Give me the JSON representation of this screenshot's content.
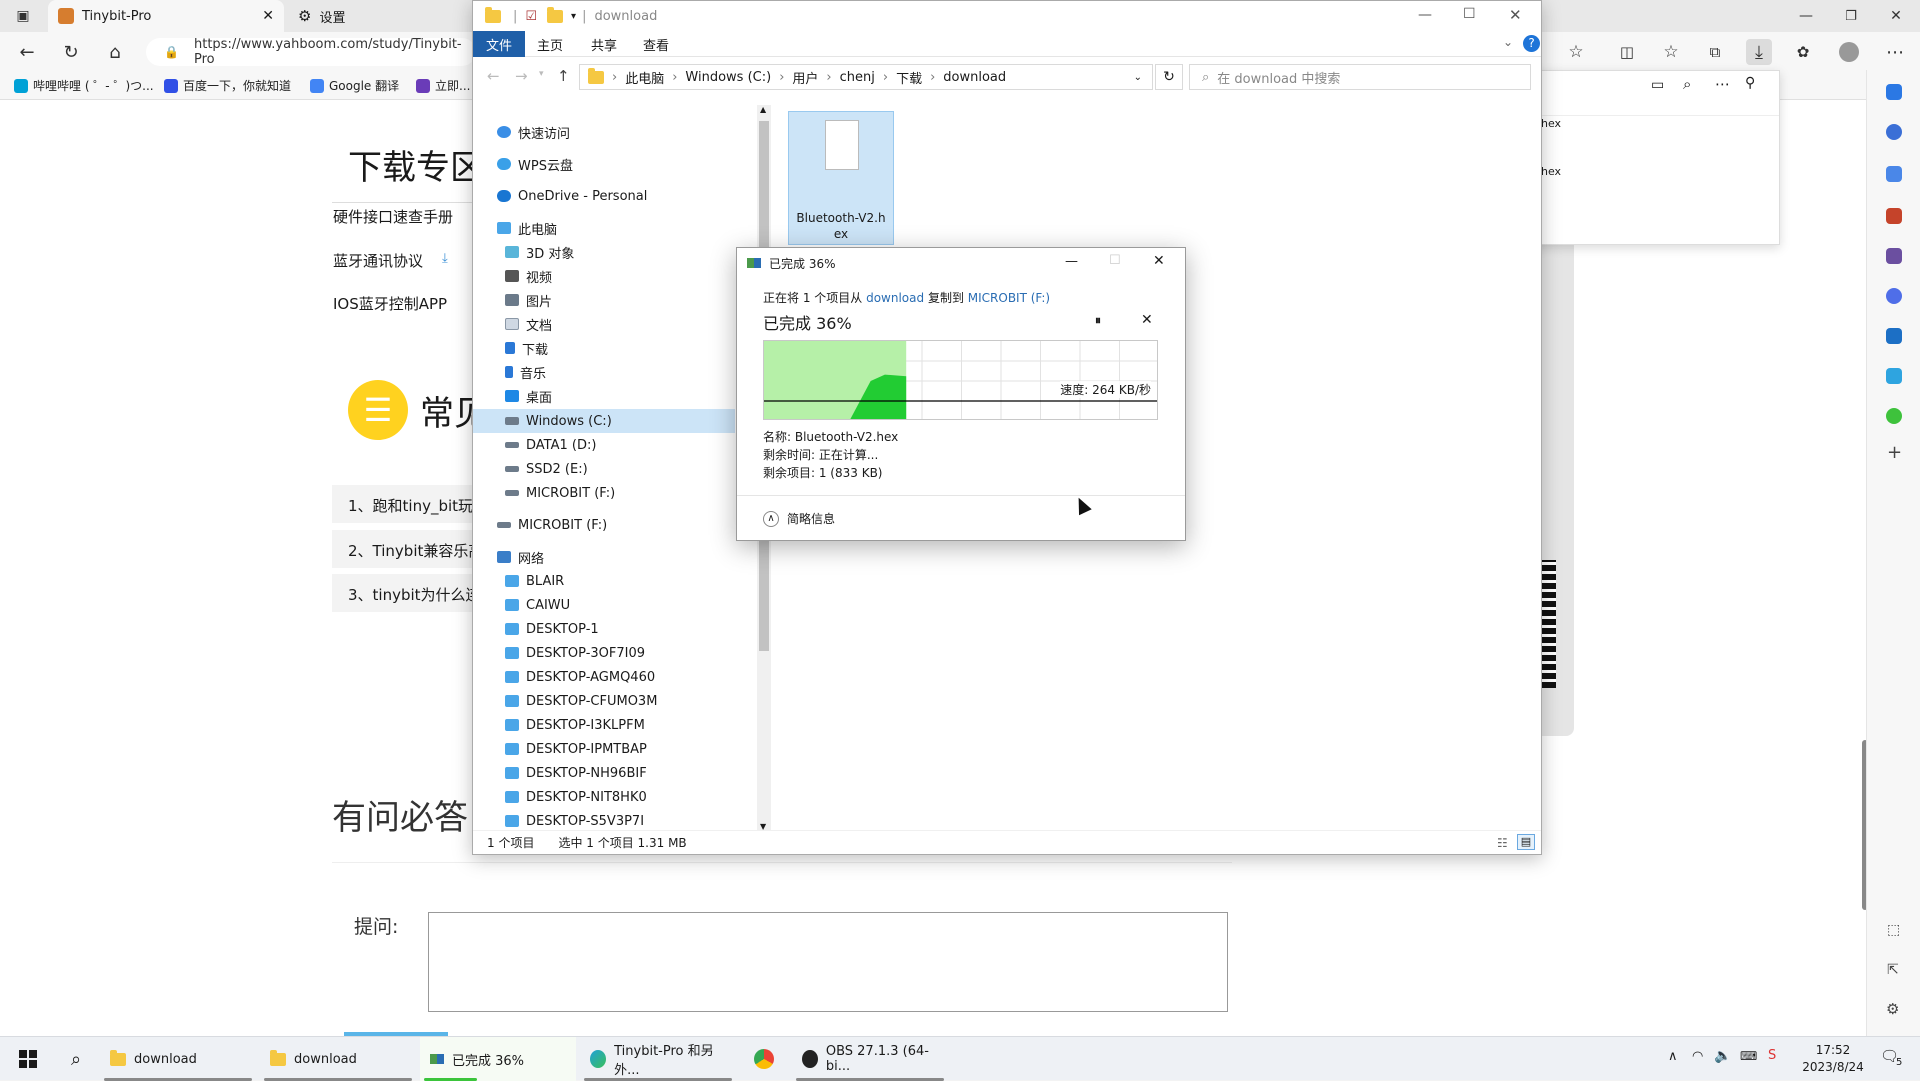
{
  "browser": {
    "tabs": [
      {
        "label": "Tinybit-Pro",
        "active": true
      },
      {
        "label": "设置",
        "active": false
      }
    ],
    "address": "https://www.yahboom.com/study/Tinybit-Pro",
    "favorites": [
      "哔哩哔哩 ( ゜- ゜)つ...",
      "百度一下，你就知道",
      "Google 翻译",
      "立即..."
    ],
    "page": {
      "heading": "下载专区",
      "links": [
        "硬件接口速查手册",
        "蓝牙通讯协议",
        "IOS蓝牙控制APP"
      ],
      "faq_heading": "常见",
      "faq_items": [
        "1、跑和tiny_bit玩",
        "2、Tinybit兼容乐高",
        "3、tinybit为什么连"
      ],
      "qa_heading": "有问必答",
      "ask_label": "提问:"
    },
    "downloads_panel": {
      "items": [
        "hex",
        "hex"
      ]
    }
  },
  "explorer": {
    "title": "download",
    "ribbon_tabs": [
      "文件",
      "主页",
      "共享",
      "查看"
    ],
    "breadcrumb": [
      "此电脑",
      "Windows (C:)",
      "用户",
      "chenj",
      "下载",
      "download"
    ],
    "search_placeholder": "在 download 中搜索",
    "sidebar": [
      {
        "label": "快速访问",
        "level": 0,
        "icon": "star-icon"
      },
      {
        "label": "WPS云盘",
        "level": 0,
        "icon": "cloud-icon"
      },
      {
        "label": "OneDrive - Personal",
        "level": 0,
        "icon": "cloud-icon"
      },
      {
        "label": "此电脑",
        "level": 0,
        "icon": "pc-icon"
      },
      {
        "label": "3D 对象",
        "level": 1,
        "icon": "cube-icon"
      },
      {
        "label": "视频",
        "level": 1,
        "icon": "video-icon"
      },
      {
        "label": "图片",
        "level": 1,
        "icon": "picture-icon"
      },
      {
        "label": "文档",
        "level": 1,
        "icon": "document-icon"
      },
      {
        "label": "下载",
        "level": 1,
        "icon": "download-icon"
      },
      {
        "label": "音乐",
        "level": 1,
        "icon": "music-icon"
      },
      {
        "label": "桌面",
        "level": 1,
        "icon": "desktop-icon"
      },
      {
        "label": "Windows (C:)",
        "level": 1,
        "icon": "drive-icon",
        "selected": true
      },
      {
        "label": "DATA1 (D:)",
        "level": 1,
        "icon": "drive-icon"
      },
      {
        "label": "SSD2 (E:)",
        "level": 1,
        "icon": "drive-icon"
      },
      {
        "label": "MICROBIT (F:)",
        "level": 1,
        "icon": "drive-icon"
      },
      {
        "label": "MICROBIT (F:)",
        "level": 0,
        "icon": "drive-icon"
      },
      {
        "label": "网络",
        "level": 0,
        "icon": "network-icon"
      },
      {
        "label": "BLAIR",
        "level": 1,
        "icon": "computer-icon"
      },
      {
        "label": "CAIWU",
        "level": 1,
        "icon": "computer-icon"
      },
      {
        "label": "DESKTOP-1",
        "level": 1,
        "icon": "computer-icon"
      },
      {
        "label": "DESKTOP-3OF7I09",
        "level": 1,
        "icon": "computer-icon"
      },
      {
        "label": "DESKTOP-AGMQ460",
        "level": 1,
        "icon": "computer-icon"
      },
      {
        "label": "DESKTOP-CFUMO3M",
        "level": 1,
        "icon": "computer-icon"
      },
      {
        "label": "DESKTOP-I3KLPFM",
        "level": 1,
        "icon": "computer-icon"
      },
      {
        "label": "DESKTOP-IPMTBAP",
        "level": 1,
        "icon": "computer-icon"
      },
      {
        "label": "DESKTOP-NH96BIF",
        "level": 1,
        "icon": "computer-icon"
      },
      {
        "label": "DESKTOP-NIT8HK0",
        "level": 1,
        "icon": "computer-icon"
      },
      {
        "label": "DESKTOP-S5V3P7I",
        "level": 1,
        "icon": "computer-icon"
      }
    ],
    "file": {
      "name_line1": "Bluetooth-V2.h",
      "name_line2": "ex"
    },
    "status": {
      "count": "1 个项目",
      "selected": "选中 1 个项目  1.31 MB"
    }
  },
  "copy_dialog": {
    "title": "已完成 36%",
    "line_prefix": "正在将 1 个项目从 ",
    "source": "download",
    "line_mid": " 复制到 ",
    "target": "MICROBIT (F:)",
    "progress_label": "已完成 36%",
    "progress": 0.36,
    "speed": "速度: 264 KB/秒",
    "name": "名称: Bluetooth-V2.hex",
    "time_left": "剩余时间: 正在计算...",
    "items_left": "剩余项目: 1 (833 KB)",
    "less_details": "简略信息",
    "colors": {
      "progress_bg": "#b6f0a8",
      "progress_fill": "#22cc33"
    }
  },
  "taskbar": {
    "tasks": [
      "download",
      "download",
      "已完成 36%",
      "Tinybit-Pro 和另外...",
      "",
      "OBS 27.1.3 (64-bi..."
    ],
    "time": "17:52",
    "date": "2023/8/24",
    "notif_count": "5"
  }
}
